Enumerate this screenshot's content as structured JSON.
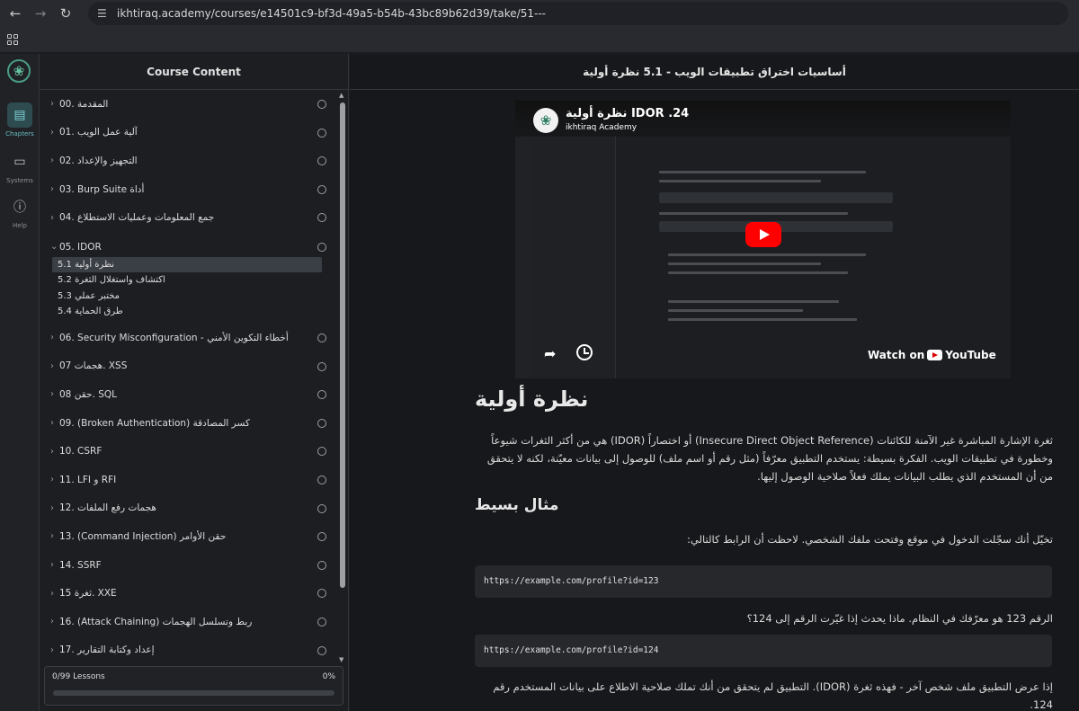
{
  "browser": {
    "url": "ikhtiraq.academy/courses/e14501c9-bf3d-49a5-b54b-43bc89b62d39/take/51---"
  },
  "rail": {
    "items": [
      {
        "label": "Chapters"
      },
      {
        "label": "Systems"
      },
      {
        "label": "Help"
      }
    ]
  },
  "sidebar": {
    "title": "Course Content",
    "chapters": [
      {
        "label": "المقدمة .00"
      },
      {
        "label": "آلية عمل الويب .01"
      },
      {
        "label": "التجهيز والإعداد .02"
      },
      {
        "label": "03. Burp Suite أداة"
      },
      {
        "label": "جمع المعلومات وعمليات الاستطلاع .04"
      },
      {
        "label": "05. IDOR"
      },
      {
        "label": "06. Security Misconfiguration - أخطاء التكوين الأمني"
      },
      {
        "label": "هجمات 07. XSS"
      },
      {
        "label": "حقن 08. SQL"
      },
      {
        "label": "09. (Broken Authentication) كسر المصادقة"
      },
      {
        "label": "10. CSRF"
      },
      {
        "label": "11. LFI و RFI"
      },
      {
        "label": "هجمات رفع الملفات .12"
      },
      {
        "label": "13. (Command Injection) حقن الأوامر"
      },
      {
        "label": "14. SSRF"
      },
      {
        "label": "ثغرة 15. XXE"
      },
      {
        "label": "16. (Attack Chaining) ربط وتسلسل الهجمات"
      },
      {
        "label": "إعداد وكتابة التقارير .17"
      }
    ],
    "lessons": [
      {
        "label": "5.1 نظرة أولية"
      },
      {
        "label": "5.2 اكتشاف واستغلال الثغرة"
      },
      {
        "label": "5.3 مختبر عملي"
      },
      {
        "label": "5.4 طرق الحماية"
      }
    ],
    "progress": {
      "label": "0/99 Lessons",
      "percent_text": "0%",
      "fraction": 0
    }
  },
  "main": {
    "title": "أساسيات اختراق تطبيقات الويب - 5.1 نظرة أولية",
    "video": {
      "title": "24. IDOR نظرة أولية",
      "channel": "ikhtiraq Academy",
      "watch_on": "Watch on",
      "youtube": "YouTube"
    },
    "article": {
      "h1": "نظرة أولية",
      "p1": "ثغرة الإشارة المباشرة غير الآمنة للكائنات (Insecure Direct Object Reference) أو اختصاراً (IDOR) هي من أكثر الثغرات شيوعاً وخطورة في تطبيقات الويب. الفكرة بسيطة: يستخدم التطبيق معرّفاً (مثل رقم أو اسم ملف) للوصول إلى بيانات معيّنة، لكنه لا يتحقق من أن المستخدم الذي يطلب البيانات يملك فعلاً صلاحية الوصول إليها.",
      "h2": "مثال بسيط",
      "p2": "تخيّل أنك سجّلت الدخول في موقع وفتحت ملفك الشخصي. لاحظت أن الرابط كالتالي:",
      "code1": "https://example.com/profile?id=123",
      "p3": "الرقم 123 هو معرّفك في النظام. ماذا يحدث إذا غيّرت الرقم إلى 124؟",
      "code2": "https://example.com/profile?id=124",
      "p4": "إذا عرض التطبيق ملف شخص آخر - فهذه ثغرة (IDOR). التطبيق لم يتحقق من أنك تملك صلاحية الاطلاع على بيانات المستخدم رقم 124."
    }
  }
}
